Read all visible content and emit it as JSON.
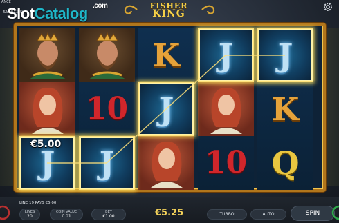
{
  "header": {
    "top_label": "ANCE",
    "balance_partial": "€990.00",
    "watermark": {
      "part1": "Slot",
      "part2": "Catalog",
      "suffix": ".com"
    },
    "game_title_line1": "FISHER",
    "game_title_line2": "KING"
  },
  "reels": [
    [
      "king",
      "queen",
      "J"
    ],
    [
      "king",
      "10",
      "J"
    ],
    [
      "K",
      "J",
      "queen"
    ],
    [
      "J",
      "queen",
      "10"
    ],
    [
      "J",
      "K",
      "Q"
    ]
  ],
  "win": {
    "amount_on_reel": "€5.00",
    "line_text": "LINE 19 PAYS €5.00",
    "total": "€5.25",
    "line_color": "#ffe27a"
  },
  "controls": {
    "lines_label": "LINES",
    "lines_value": "20",
    "coin_value_label": "COIN VALUE",
    "coin_value": "0.01",
    "bet_label": "BET",
    "bet_value": "€1.00",
    "turbo_label": "TURBO",
    "auto_label": "AUTO",
    "spin_label": "SPIN"
  },
  "icons": [
    "gear-icon",
    "title-swirl-left-icon",
    "title-swirl-right-icon",
    "menu-ring-icon",
    "info-ring-icon"
  ],
  "colors": {
    "frame_gold": "#b1761c",
    "accent_gold": "#f2d15a",
    "watermark_teal": "#1fb6c8"
  }
}
